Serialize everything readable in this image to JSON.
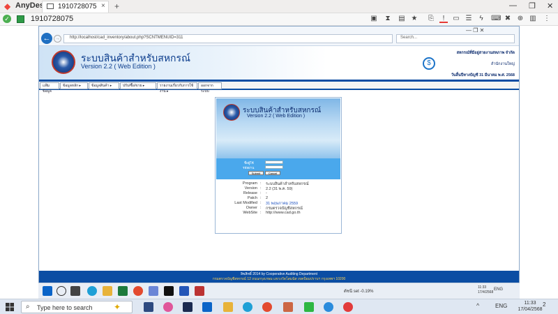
{
  "anydesk": {
    "app_name": "AnyDesk",
    "tab_label": "1910728075",
    "tab_close": "×",
    "tab_add": "+",
    "session_id": "1910728075",
    "window_controls": [
      "—",
      "❐",
      "✕"
    ]
  },
  "browser": {
    "address": "http://localhost/cad_inventory/about.php?SCNTMENUID=311",
    "search_placeholder": "Search...",
    "mini_controls": "—  ❐  ✕"
  },
  "app": {
    "title": "ระบบสินค้าสำหรับสหกรณ์",
    "version": "Version 2.2 ( Web Edition )",
    "header_right": {
      "org": "สหกรณ์ที่มีอยู่สายงานสหภาพ จำกัด",
      "branch": "สำนักงานใหญ่",
      "fiscal": "วันสิ้นปีทางบัญชี 31 มีนาคม พ.ศ. 2568"
    },
    "menu": [
      "แฟ้มข้อมูล",
      "ข้อมูลหลัก ▸",
      "ข้อมูลสินค้า ▸",
      "ปรับ/ซื้อ/ขาย ▸",
      "รายงานเกี่ยวกับการใช้งาน ▸",
      "ออกจากระบบ"
    ]
  },
  "login": {
    "title": "ระบบสินค้าสำหรับสหกรณ์",
    "version": "Version 2.2 ( Web Edition )",
    "user_label": "ชื่อผู้ใช้",
    "pass_label": "รหัสผ่าน",
    "submit": "Submit",
    "cancel": "Cancel"
  },
  "info": [
    {
      "key": "Program",
      "value": "ระบบสินค้าสำหรับสหกรณ์"
    },
    {
      "key": "Version",
      "value": "2.2 (31 พ.ค. 59)"
    },
    {
      "key": "Release",
      "value": "-"
    },
    {
      "key": "Patch",
      "value": "2"
    },
    {
      "key": "Last Modified",
      "value": "31 พฤษภาคม 2559"
    },
    {
      "key": "Owner",
      "value": "กรมตรวจบัญชีสหกรณ์"
    },
    {
      "key": "WebSite",
      "value": "http://www.cad.go.th"
    }
  ],
  "footer": {
    "line1": "ลิขสิทธิ์ 2014 by Cooperative Auditing Department",
    "line2": "กรมตรวจบัญชีสหกรณ์ 12 ถนนกรุงเกษม แขวงวัดโสมนัส เขตป้อมปราบฯ กรุงเทพฯ 10200"
  },
  "remote_taskbar": {
    "market": "ดัชนี set  -0.19%",
    "lang": "ENG",
    "clock": "11:33\n17/4/2568"
  },
  "local_taskbar": {
    "search_placeholder": "Type here to search",
    "lang": "ENG",
    "time": "11:33",
    "date": "17/04/2568",
    "notif_count": "2",
    "chevron": "^"
  }
}
